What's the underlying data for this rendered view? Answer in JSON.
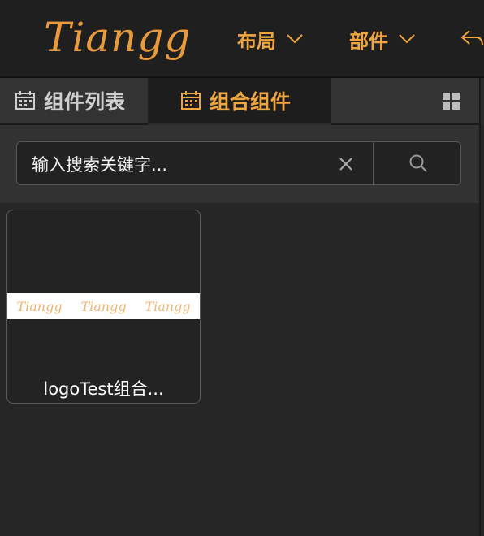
{
  "header": {
    "logo_text": "Tiangg",
    "menus": [
      {
        "label": "布局"
      },
      {
        "label": "部件"
      }
    ]
  },
  "tabs": [
    {
      "label": "组件列表",
      "active": false
    },
    {
      "label": "组合组件",
      "active": true
    }
  ],
  "search": {
    "value": "输入搜索关键字..."
  },
  "cards": [
    {
      "title": "logoTest组合...",
      "thumbnail_text": "Tiangg"
    }
  ],
  "colors": {
    "accent": "#f0a640",
    "background": "#262626",
    "header_bg": "#1f1f1f"
  },
  "icons": [
    "calendar-icon",
    "chevron-down-icon",
    "undo-icon",
    "grid-view-icon",
    "clear-icon",
    "search-icon"
  ]
}
